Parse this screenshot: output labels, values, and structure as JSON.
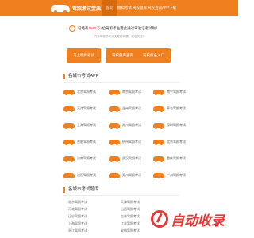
{
  "nav": {
    "logo_text": "驾照考试宝典",
    "items": [
      "首页",
      "模拟考试",
      "驾校题库",
      "驾校查询",
      "APP下载"
    ]
  },
  "notice": {
    "icon": "!",
    "prefix": "已经有",
    "count": "1868万+",
    "suffix": "位驾照考生用此通过驾驶证考试啦！",
    "sub": "汽车驾驶员考试交规仿真题，欢迎关注！"
  },
  "cta": [
    "马上模拟考试",
    "驾校题库查询",
    "驾校报名入口"
  ],
  "section_app": {
    "title": "各城市考试APP"
  },
  "cities": [
    [
      "北京驾照考试",
      "南京驾照考试",
      "南宁驾照考试"
    ],
    [
      "天津驾照考试",
      "温州驾照考试",
      "青岛驾照考试"
    ],
    [
      "上海驾照考试",
      "苏州驾照考试",
      "深圳驾照考试"
    ],
    [
      "合肥驾照考试",
      "杭州驾照考试",
      "北京驾照考试"
    ],
    [
      "济南驾照考试",
      "武汉驾照考试",
      "重庆驾照考试"
    ],
    [
      "沈阳驾照考试",
      "郑州驾照考试",
      "广州驾照考试"
    ]
  ],
  "section_bank": {
    "title": "各城市考试题库"
  },
  "bank_left": [
    "北京驾照考试",
    "河北驾照考试",
    "辽宁驾照考试",
    "上海驾照考试",
    "浙江驾照考试"
  ],
  "bank_right": [
    "天津驾照考试",
    "山西驾照考试",
    "吉林驾照考试",
    "江苏驾照考试",
    "安徽驾照考试"
  ],
  "watermark": {
    "text": "自动收录"
  },
  "colors": {
    "accent": "#f0801e",
    "highlight": "#e4393c",
    "watermark": "#e53935"
  }
}
